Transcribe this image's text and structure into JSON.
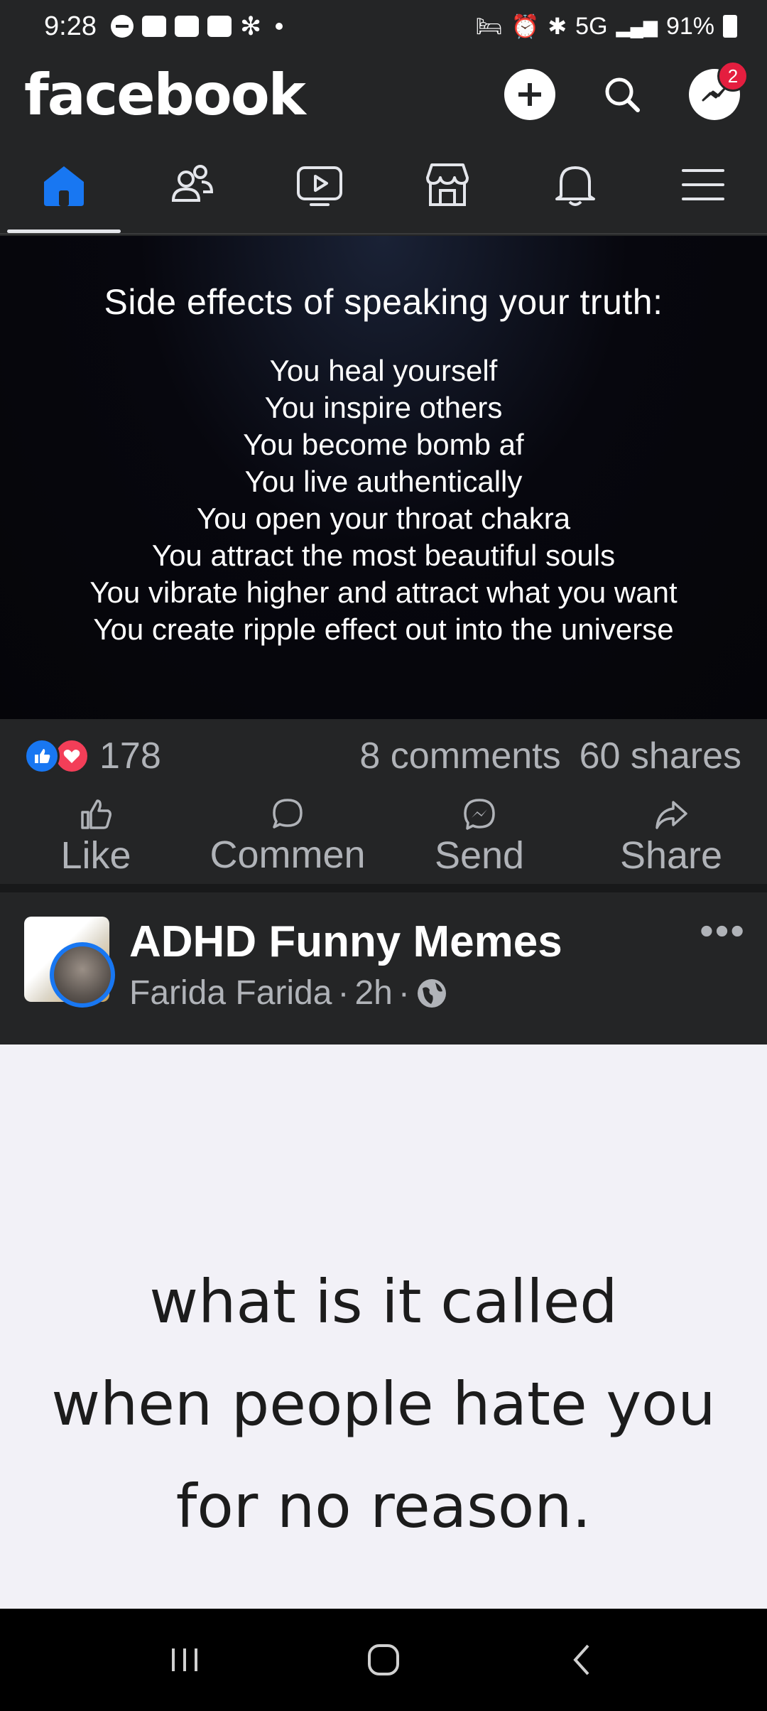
{
  "status_bar": {
    "time": "9:28",
    "network": "5G",
    "battery": "91%"
  },
  "header": {
    "logo": "facebook",
    "messenger_badge": "2"
  },
  "tabs": [
    "home-icon",
    "friends-icon",
    "video-icon",
    "marketplace-icon",
    "notifications-icon",
    "menu-icon"
  ],
  "post1": {
    "image_title": "Side effects of speaking your truth:",
    "image_lines": [
      "You heal yourself",
      "You inspire others",
      "You become bomb af",
      "You live authentically",
      "You open your throat chakra",
      "You attract the most beautiful souls",
      "You vibrate higher and attract what you want",
      "You create ripple effect out into the universe"
    ],
    "reaction_count": "178",
    "comments": "8 comments",
    "shares": "60 shares",
    "actions": {
      "like": "Like",
      "comment": "Commen",
      "send": "Send",
      "share": "Share"
    }
  },
  "post2": {
    "group": "ADHD Funny Memes",
    "author": "Farida Farida",
    "time": "2h",
    "separator": "·",
    "image_lines": [
      "what is it called",
      "when people hate you",
      "for no reason."
    ]
  },
  "colors": {
    "background": "#242526",
    "accent": "#1877f2",
    "badge": "#e41e3f"
  }
}
